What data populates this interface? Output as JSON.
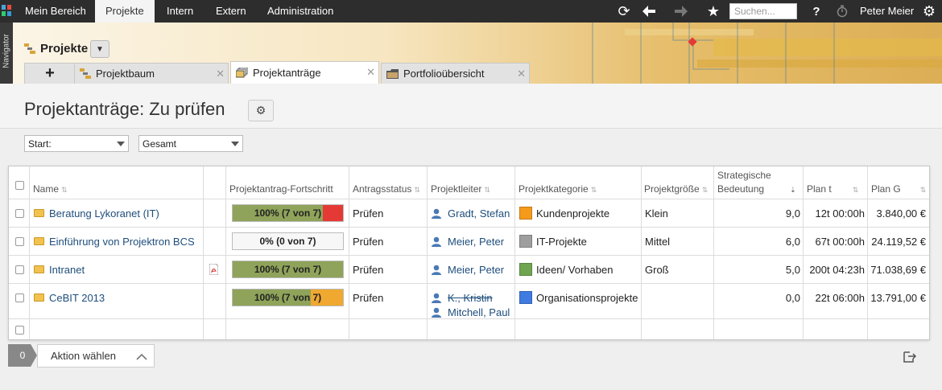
{
  "topnav": {
    "items": [
      "Mein Bereich",
      "Projekte",
      "Intern",
      "Extern",
      "Administration"
    ],
    "active_index": 1,
    "search_placeholder": "Suchen...",
    "help_label": "?",
    "user_name": "Peter Meier"
  },
  "sidebar": {
    "label": "Navigator"
  },
  "module": {
    "title": "Projekte"
  },
  "tabs": [
    {
      "label": "Projektbaum",
      "active": false
    },
    {
      "label": "Projektanträge",
      "active": true
    },
    {
      "label": "Portfolioübersicht",
      "active": false
    }
  ],
  "page": {
    "title": "Projektanträge: Zu prüfen"
  },
  "filters": {
    "start": "Start:",
    "scope": "Gesamt"
  },
  "table": {
    "headers": {
      "name": "Name",
      "progress": "Projektantrag-Fortschritt",
      "status": "Antragsstatus",
      "leader": "Projektleiter",
      "category": "Projektkategorie",
      "size": "Projektgröße",
      "strategic_line1": "Strategische",
      "strategic_line2": "Bedeutung",
      "plan_t": "Plan t",
      "plan_g": "Plan G"
    },
    "rows": [
      {
        "name": "Beratung Lykoranet (IT)",
        "has_pdf": false,
        "progress_label": "100% (7 von 7)",
        "progress_segments": [
          {
            "fraction": 0.82,
            "color": "#8fa35a"
          },
          {
            "fraction": 0.18,
            "color": "#e53935"
          }
        ],
        "status": "Prüfen",
        "leaders": [
          {
            "name": "Gradt, Stefan",
            "struck": false
          }
        ],
        "category": "Kundenprojekte",
        "category_color": "#f59a1b",
        "size": "Klein",
        "strategic": "9,0",
        "plan_t": "12t 00:00h",
        "plan_g": "3.840,00 €"
      },
      {
        "name": "Einführung von Projektron BCS",
        "has_pdf": false,
        "progress_label": "0% (0 von 7)",
        "progress_segments": [],
        "status": "Prüfen",
        "leaders": [
          {
            "name": "Meier, Peter",
            "struck": false
          }
        ],
        "category": "IT-Projekte",
        "category_color": "#9e9e9e",
        "size": "Mittel",
        "strategic": "6,0",
        "plan_t": "67t 00:00h",
        "plan_g": "24.119,52 €"
      },
      {
        "name": "Intranet",
        "has_pdf": true,
        "progress_label": "100% (7 von 7)",
        "progress_segments": [
          {
            "fraction": 1.0,
            "color": "#8fa35a"
          }
        ],
        "status": "Prüfen",
        "leaders": [
          {
            "name": "Meier, Peter",
            "struck": false
          }
        ],
        "category": "Ideen/ Vorhaben",
        "category_color": "#6fa550",
        "size": "Groß",
        "strategic": "5,0",
        "plan_t": "200t 04:23h",
        "plan_g": "71.038,69 €"
      },
      {
        "name": "CeBIT 2013",
        "has_pdf": false,
        "progress_label": "100% (7 von 7)",
        "progress_segments": [
          {
            "fraction": 0.71,
            "color": "#8fa35a"
          },
          {
            "fraction": 0.29,
            "color": "#f0a830"
          }
        ],
        "status": "Prüfen",
        "leaders": [
          {
            "name": "K., Kristin",
            "struck": true
          },
          {
            "name": "Mitchell, Paul",
            "struck": false
          }
        ],
        "category": "Organisationsprojekte",
        "category_color": "#3f7be0",
        "size": "",
        "strategic": "0,0",
        "plan_t": "22t 06:00h",
        "plan_g": "13.791,00 €"
      }
    ]
  },
  "footer": {
    "selected_count": "0",
    "action_label": "Aktion wählen"
  }
}
